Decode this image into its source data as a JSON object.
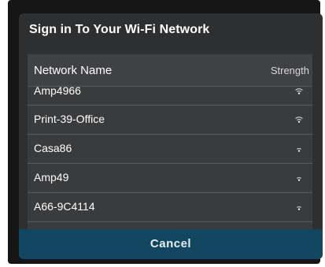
{
  "dialog": {
    "title": "Sign in To Your Wi-Fi Network"
  },
  "list": {
    "header_name": "Network Name",
    "header_strength": "Strength",
    "networks": [
      {
        "label": "Amp4966",
        "icon": "wifi-signal-icon"
      },
      {
        "label": "Print-39-Office",
        "icon": "wifi-signal-icon"
      },
      {
        "label": "Casa86",
        "icon": "wifi-signal-icon"
      },
      {
        "label": "Amp49",
        "icon": "wifi-signal-icon"
      },
      {
        "label": "A66-9C4114",
        "icon": "wifi-signal-icon"
      }
    ]
  },
  "actions": {
    "cancel_label": "Cancel"
  },
  "colors": {
    "dialog_bg": "#2e2f31",
    "list_bg": "#3a3b3d",
    "header_bg": "#404144",
    "cancel_bg": "#134660",
    "text": "#ffffff"
  }
}
